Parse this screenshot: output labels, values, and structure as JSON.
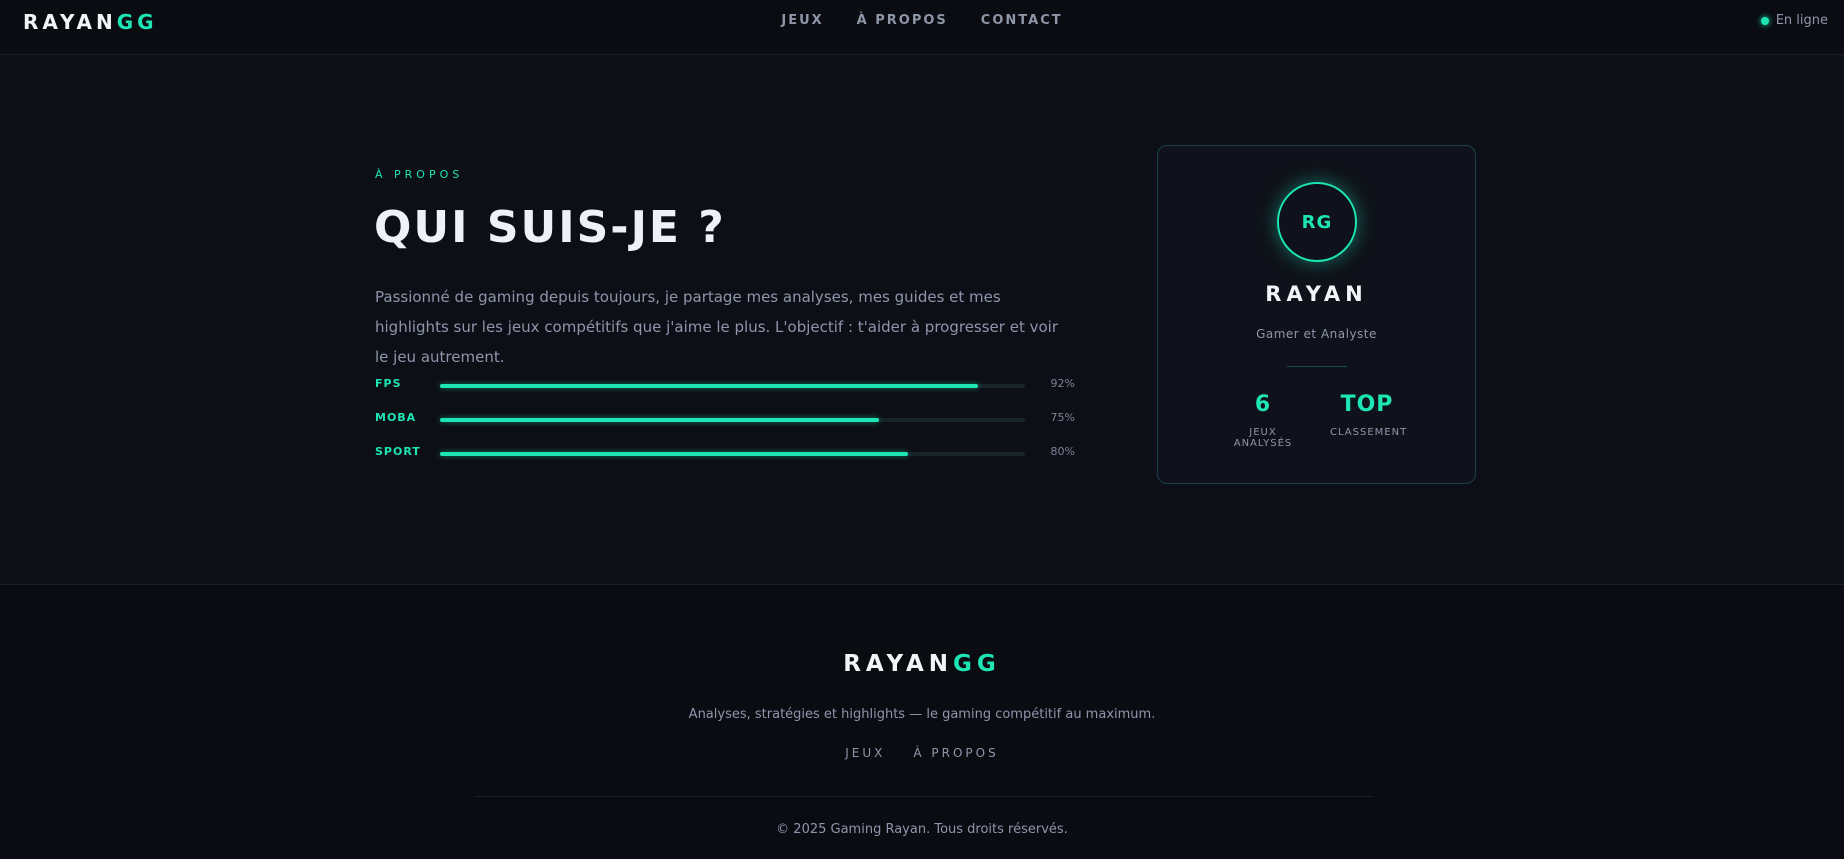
{
  "header": {
    "logo_main": "RAYAN",
    "logo_accent": "GG",
    "nav": [
      "JEUX",
      "À PROPOS",
      "CONTACT"
    ],
    "status": "En ligne"
  },
  "about": {
    "eyebrow": "À PROPOS",
    "title": "QUI SUIS-JE ?",
    "paragraph": "Passionné de gaming depuis toujours, je partage mes analyses, mes guides et mes highlights sur les jeux compétitifs que j'aime le plus. L'objectif : t'aider à progresser et voir le jeu autrement.",
    "skills": [
      {
        "label": "FPS",
        "percent": 92,
        "percent_text": "92%"
      },
      {
        "label": "MOBA",
        "percent": 75,
        "percent_text": "75%"
      },
      {
        "label": "SPORT",
        "percent": 80,
        "percent_text": "80%"
      }
    ]
  },
  "profile_card": {
    "initials": "RG",
    "name": "RAYAN",
    "role": "Gamer et Analyste",
    "stats": [
      {
        "value": "6",
        "label": "JEUX ANALYSÉS"
      },
      {
        "value": "TOP",
        "label": "CLASSEMENT"
      }
    ]
  },
  "footer": {
    "logo_main": "RAYAN",
    "logo_accent": "GG",
    "tagline": "Analyses, stratégies et highlights — le gaming compétitif au maximum.",
    "links": [
      "JEUX",
      "À PROPOS"
    ],
    "copyright": "© 2025 Gaming Rayan. Tous droits réservés."
  },
  "colors": {
    "background": "#0d0f16",
    "accent": "#1de5b4",
    "text_muted": "#8f96ab"
  }
}
